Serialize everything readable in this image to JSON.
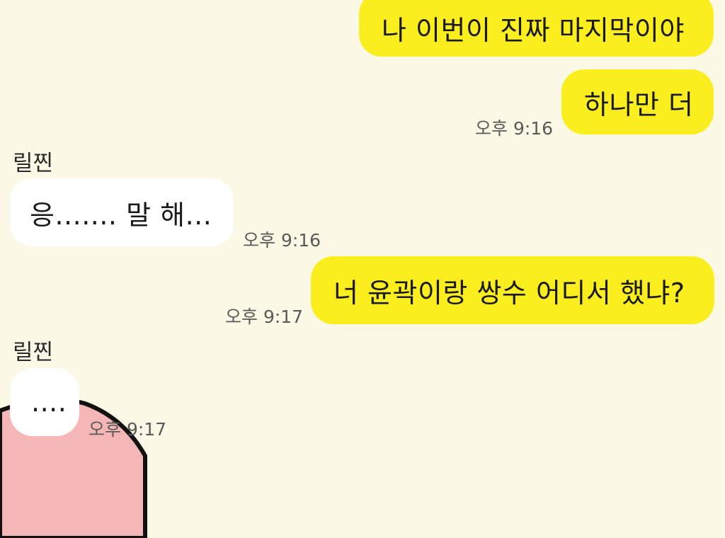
{
  "messages": [
    {
      "kind": "sent",
      "text": "나 이번이 진짜 마지막이야",
      "time": ""
    },
    {
      "kind": "sent",
      "text": "하나만 더",
      "time": "오후 9:16"
    },
    {
      "kind": "received",
      "sender": "릴찐",
      "text": "응....... 말 해...",
      "time": "오후 9:16"
    },
    {
      "kind": "sent",
      "text": "너 윤곽이랑 쌍수 어디서 했냐?",
      "time": "오후 9:17"
    },
    {
      "kind": "received",
      "sender": "릴찐",
      "text": "....",
      "time": "오후 9:17"
    }
  ],
  "colors": {
    "background": "#fbf8e6",
    "sent_bubble": "#fbee1f",
    "received_bubble": "#ffffff",
    "decor_pink": "#f4b6b6"
  }
}
